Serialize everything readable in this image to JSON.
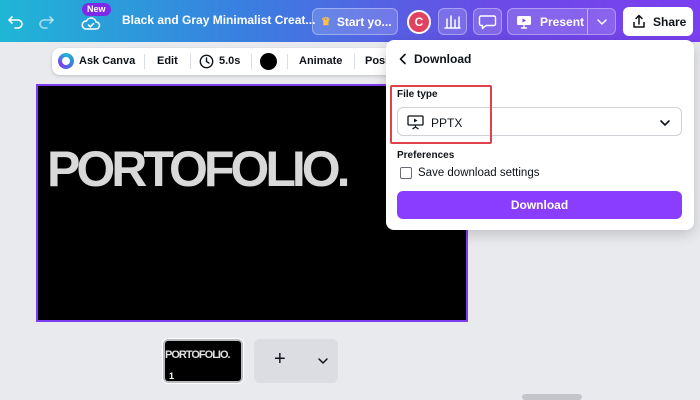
{
  "topbar": {
    "new_badge": "New",
    "doc_title": "Black and Gray Minimalist Creat...",
    "start_label": "Start yo...",
    "avatar_initial": "C",
    "present_label": "Present",
    "share_label": "Share"
  },
  "toolbar": {
    "ask_canva": "Ask Canva",
    "edit": "Edit",
    "duration": "5.0s",
    "animate": "Animate",
    "position": "Posi"
  },
  "slide": {
    "title": "PORTOFOLIO."
  },
  "pages": {
    "thumb_title": "PORTOFOLIO.",
    "thumb_number": "1"
  },
  "download_panel": {
    "title": "Download",
    "file_type_label": "File type",
    "file_type_value": "PPTX",
    "preferences_label": "Preferences",
    "save_settings_label": "Save download settings",
    "save_settings_checked": false,
    "download_button": "Download"
  },
  "colors": {
    "accent": "#8b3dff",
    "highlight": "#e0424b"
  }
}
